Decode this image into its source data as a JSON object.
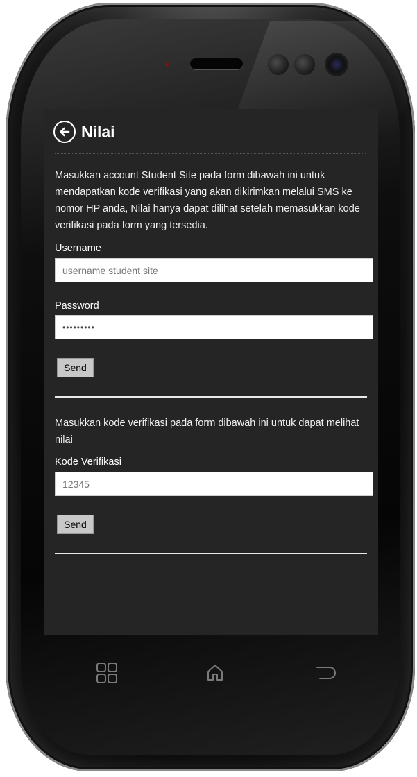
{
  "app": {
    "title": "Nilai"
  },
  "intro_text": "Masukkan account Student Site pada form dibawah ini untuk mendapatkan kode verifikasi yang akan dikirimkan melalui SMS ke nomor HP anda, Nilai hanya dapat dilihat setelah memasukkan kode verifikasi pada form yang tersedia.",
  "login_form": {
    "username_label": "Username",
    "username_value": "username student site",
    "password_label": "Password",
    "password_value": "•••••••••",
    "send_label": "Send"
  },
  "verify_form": {
    "instruction": "Masukkan kode verifikasi pada form dibawah ini untuk dapat melihat nilai",
    "code_label": "Kode Verifikasi",
    "code_value": "12345",
    "send_label": "Send"
  },
  "icons": {
    "back": "back-arrow-icon",
    "recent_apps": "recent-apps-icon",
    "home": "home-icon",
    "back_nav": "return-icon"
  },
  "colors": {
    "screen_bg": "#252525",
    "text": "#ffffff",
    "input_bg": "#ffffff",
    "button_bg": "#c8c8c8"
  }
}
